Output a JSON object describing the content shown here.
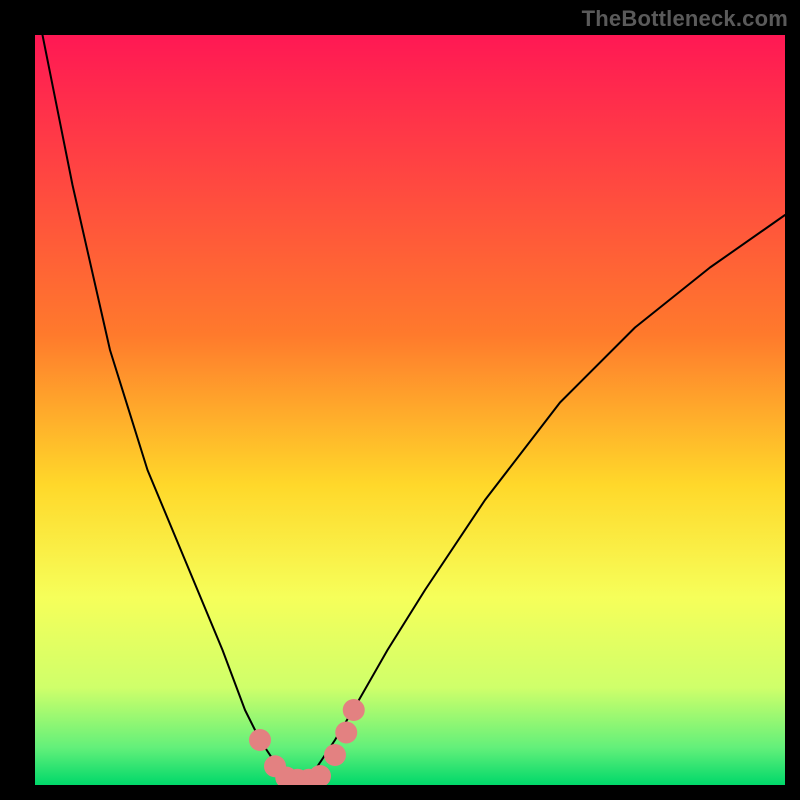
{
  "watermark": "TheBottleneck.com",
  "chart_data": {
    "type": "line",
    "title": "",
    "xlabel": "",
    "ylabel": "",
    "xlim": [
      0,
      100
    ],
    "ylim": [
      0,
      100
    ],
    "gradient_stops": [
      {
        "offset": 0.0,
        "color": "#ff1854"
      },
      {
        "offset": 0.4,
        "color": "#ff7a2c"
      },
      {
        "offset": 0.6,
        "color": "#ffd82a"
      },
      {
        "offset": 0.75,
        "color": "#f6ff5a"
      },
      {
        "offset": 0.87,
        "color": "#cfff6a"
      },
      {
        "offset": 0.95,
        "color": "#63f07a"
      },
      {
        "offset": 1.0,
        "color": "#00d86a"
      }
    ],
    "series": [
      {
        "name": "bottleneck-curve",
        "type": "line",
        "color": "#000000",
        "stroke_width": 2,
        "x": [
          1,
          5,
          10,
          15,
          20,
          25,
          28,
          30,
          32,
          33,
          34,
          35,
          36,
          37,
          38,
          40,
          43,
          47,
          52,
          60,
          70,
          80,
          90,
          100
        ],
        "y": [
          100,
          80,
          58,
          42,
          30,
          18,
          10,
          6,
          3,
          1.5,
          0.8,
          0.5,
          0.8,
          1.5,
          3,
          6,
          11,
          18,
          26,
          38,
          51,
          61,
          69,
          76
        ]
      },
      {
        "name": "highlight-markers",
        "type": "scatter",
        "color": "#e38181",
        "marker_radius": 11,
        "x": [
          30.0,
          32.0,
          33.5,
          35.0,
          36.5,
          38.0,
          40.0,
          41.5,
          42.5
        ],
        "y": [
          6.0,
          2.5,
          1.0,
          0.7,
          0.7,
          1.2,
          4.0,
          7.0,
          10.0
        ]
      }
    ]
  }
}
